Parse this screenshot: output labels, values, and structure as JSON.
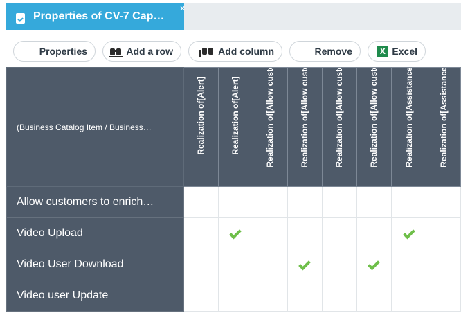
{
  "tab": {
    "title": "Properties of CV-7 Cap…",
    "icon": "document-check-icon",
    "close": "×",
    "color": "#35a9db"
  },
  "toolbar": {
    "properties_label": "Properties",
    "add_row_label": "Add a row",
    "add_column_label": "Add  column",
    "remove_label": "Remove",
    "excel_label": "Excel",
    "excel_icon_text": "X"
  },
  "grid": {
    "corner_label": "(Business Catalog Item / Business…",
    "columns": [
      "Realization of[Alert]",
      "Realization of[Alert]",
      "Realization of[Allow custo",
      "Realization of[Allow custo",
      "Realization of[Allow custo",
      "Realization of[Allow custo",
      "Realization of[Assistance]",
      "Realization of[Assistance]"
    ],
    "rows": [
      {
        "label": "Allow customers to enrich…",
        "checks": [
          false,
          false,
          false,
          false,
          false,
          false,
          false,
          false
        ]
      },
      {
        "label": "Video Upload",
        "checks": [
          false,
          true,
          false,
          false,
          false,
          false,
          true,
          false
        ]
      },
      {
        "label": "Video User Download",
        "checks": [
          false,
          false,
          false,
          true,
          false,
          true,
          false,
          false
        ]
      },
      {
        "label": "Video user Update",
        "checks": [
          false,
          false,
          false,
          false,
          false,
          false,
          false,
          false
        ]
      }
    ],
    "header_color": "#4e5a69",
    "check_color": "#6fbf4a"
  }
}
